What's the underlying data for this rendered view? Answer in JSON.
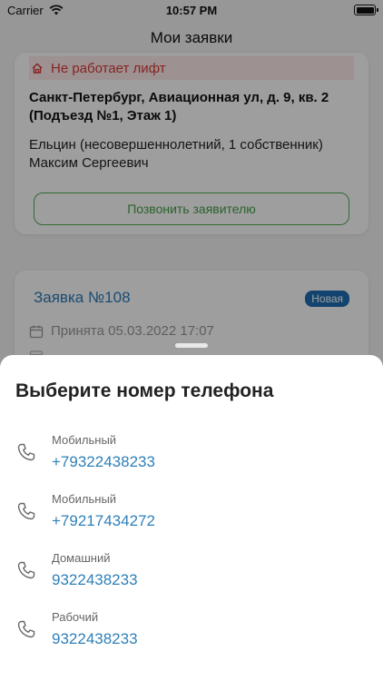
{
  "status_bar": {
    "carrier": "Carrier",
    "time": "10:57 PM"
  },
  "nav": {
    "title": "Мои заявки"
  },
  "card1": {
    "warning": "Не работает лифт",
    "address": "Санкт-Петербург, Авиационная ул, д. 9, кв. 2 (Подъезд №1, Этаж 1)",
    "owner": "Ельцин (несовершеннолетний, 1 собственник) Максим Сергеевич",
    "call_button": "Позвонить заявителю"
  },
  "card2": {
    "title": "Заявка №108",
    "status": "Новая",
    "accepted": "Принята 05.03.2022 17:07"
  },
  "sheet": {
    "title": "Выберите номер телефона",
    "phones": [
      {
        "type": "Мобильный",
        "number": "+79322438233"
      },
      {
        "type": "Мобильный",
        "number": "+79217434272"
      },
      {
        "type": "Домашний",
        "number": "9322438233"
      },
      {
        "type": "Рабочий",
        "number": "9322438233"
      }
    ]
  },
  "colors": {
    "accent": "#2f80b9",
    "green": "#43a047",
    "warning": "#d83a3a",
    "badge": "#1f6fb5"
  }
}
